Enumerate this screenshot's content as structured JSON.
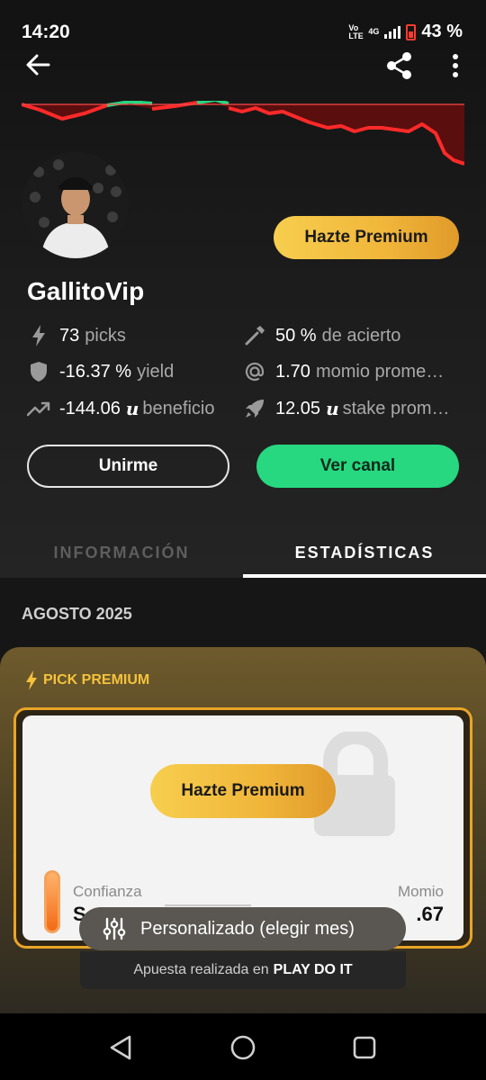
{
  "status_bar": {
    "time": "14:20",
    "net_top": "Vo LTE",
    "net_mid": "4G",
    "battery_pct": "43 %"
  },
  "header": {
    "sparkline_colors": {
      "positive": "#27d880",
      "negative": "#ff2a2a",
      "fill": "#5a0e0e"
    },
    "premium_button": "Hazte Premium",
    "username": "GallitoVip",
    "stats": {
      "picks_value": "73",
      "picks_label": "picks",
      "yield_value": "-16.37 %",
      "yield_label": "yield",
      "profit_value": "-144.06",
      "profit_unit": "u",
      "profit_label": "beneficio",
      "accuracy_value": "50 %",
      "accuracy_label": "de acierto",
      "odds_value": "1.70",
      "odds_label": "momio prome…",
      "stake_value": "12.05",
      "stake_unit": "u",
      "stake_label": "stake prom…"
    },
    "join_button": "Unirme",
    "channel_button": "Ver canal",
    "tabs": [
      "INFORMACIÓN",
      "ESTADÍSTICAS"
    ],
    "active_tab": "ESTADÍSTICAS"
  },
  "content": {
    "month": "AGOSTO 2025",
    "pick_label": "PICK PREMIUM",
    "premium_button": "Hazte Premium",
    "confidence_label": "Confianza",
    "confidence_value": "S",
    "odds_label": "Momio",
    "odds_value": ".67",
    "bet_prefix": "Apuesta realizada en",
    "bet_site": "PLAY DO IT"
  },
  "toast": {
    "label": "Personalizado (elegir mes)"
  },
  "colors": {
    "accent_green": "#27d880",
    "accent_gold": "#f0b63a",
    "negative_red": "#ff2a2a"
  }
}
